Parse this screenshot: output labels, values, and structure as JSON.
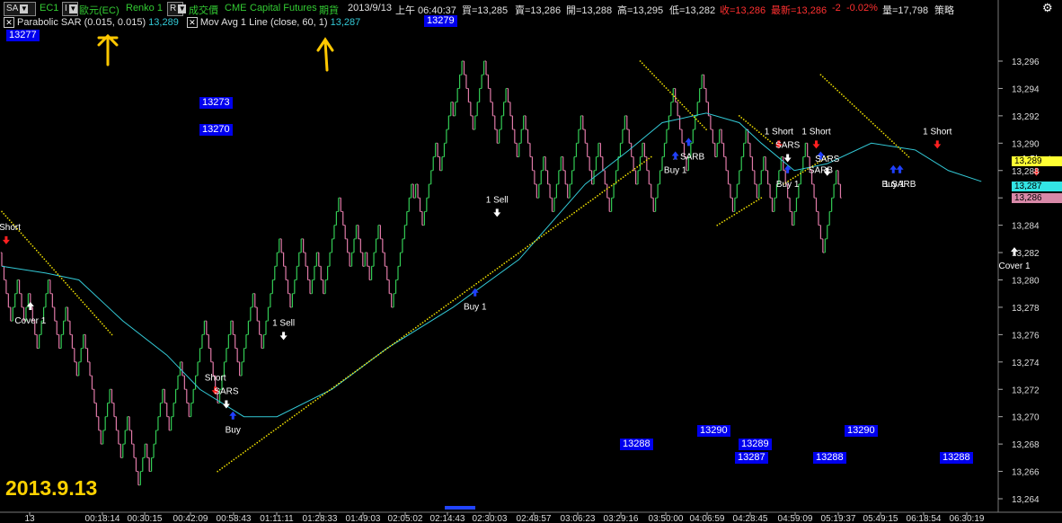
{
  "toolbar": {
    "symbol": "SA",
    "symbol_code": "EC1",
    "interval_btn": "I",
    "symbol_name": "歐元(EC)",
    "bar_type": "Renko 1",
    "mode_btn": "R",
    "price_type": "成交價",
    "exchange": "CME",
    "broker": "Capital Futures",
    "market": "期貨",
    "date": "2013/9/13",
    "time": "上午 06:40:37",
    "bid": "買=13,285",
    "ask": "賣=13,286",
    "open": "開=13,288",
    "high": "高=13,295",
    "low": "低=13,282",
    "close": "收=13,286",
    "last": "最新=13,286",
    "change": "-2",
    "change_pct": "-0.02%",
    "volume": "量=17,798",
    "strategy": "策略"
  },
  "indicators": [
    {
      "name": "Parabolic SAR",
      "params": "(0.015, 0.015)",
      "value": "13,289"
    },
    {
      "name": "Mov Avg 1 Line",
      "params": "(close, 60, 1)",
      "value": "13,287"
    }
  ],
  "notes": [
    "13277",
    "13279",
    "13273",
    "13270",
    "13288",
    "13290",
    "13289",
    "13287",
    "13288",
    "13290",
    "13288"
  ],
  "date_label": "2013.9.13",
  "price_tags": [
    "13,289",
    "13,287",
    "13,286"
  ],
  "colors": {
    "up": "#33cc55",
    "down": "#e07aa8",
    "sar": "#f5e400",
    "ma": "#33c9d6",
    "price_tag_yellow": "#ffff33",
    "price_tag_cyan": "#33e5e5",
    "price_tag_pink": "#d889a8"
  },
  "chart_data": {
    "type": "line",
    "y_axis": {
      "range": [
        13263,
        13297
      ],
      "ticks": [
        "13,296",
        "13,294",
        "13,292",
        "13,290",
        "13,288",
        "13,286",
        "13,284",
        "13,282",
        "13,280",
        "13,278",
        "13,276",
        "13,274",
        "13,272",
        "13,270",
        "13,268",
        "13,266",
        "13,264"
      ]
    },
    "x_axis": {
      "ticks": [
        "13",
        "00:18:14",
        "00:30:15",
        "00:42:09",
        "00:58:43",
        "01:11:11",
        "01:28:33",
        "01:49:03",
        "02:05:02",
        "02:14:43",
        "02:30:03",
        "02:48:57",
        "03:06:23",
        "03:29:16",
        "03:50:00",
        "04:06:59",
        "04:28:45",
        "04:59:09",
        "05:19:37",
        "05:49:15",
        "06:18:54",
        "06:30:19"
      ]
    },
    "series": [
      {
        "name": "Renko 1",
        "style": "renko",
        "path": [
          13282,
          13277,
          13280,
          13277,
          13279,
          13275,
          13280,
          13278,
          13275,
          13278,
          13273,
          13276,
          13268,
          13272,
          13267,
          13270,
          13265,
          13268,
          13266,
          13272,
          13269,
          13274,
          13270,
          13277,
          13271,
          13277,
          13273,
          13279,
          13275,
          13283,
          13278,
          13283,
          13279,
          13282,
          13279,
          13286,
          13281,
          13284,
          13281,
          13282,
          13280,
          13284,
          13278,
          13287,
          13286,
          13287,
          13284,
          13290,
          13288,
          13293,
          13292,
          13296,
          13291,
          13296,
          13290,
          13294,
          13289,
          13292,
          13286,
          13289,
          13285,
          13289,
          13286,
          13292,
          13287,
          13290,
          13285,
          13292,
          13287,
          13290,
          13285,
          13294,
          13288,
          13295,
          13289,
          13291,
          13285,
          13291,
          13286,
          13289,
          13285,
          13289,
          13284,
          13290,
          13282,
          13288,
          13286
        ]
      },
      {
        "name": "Parabolic SAR",
        "style": "dots",
        "segments": [
          [
            [
              0,
              13285
            ],
            [
              50,
              13276
            ]
          ],
          [
            [
              98,
              13266
            ],
            [
              295,
              13289
            ]
          ],
          [
            [
              290,
              13296
            ],
            [
              320,
              13291
            ]
          ],
          [
            [
              325,
              13284
            ],
            [
              345,
              13286
            ]
          ],
          [
            [
              335,
              13292
            ],
            [
              350,
              13290
            ]
          ],
          [
            [
              355,
              13287
            ],
            [
              375,
              13289
            ]
          ],
          [
            [
              372,
              13295
            ],
            [
              412,
              13289
            ]
          ]
        ]
      },
      {
        "name": "Mov Avg 1 Line",
        "style": "line",
        "points": [
          [
            0,
            13281
          ],
          [
            20,
            13280.5
          ],
          [
            35,
            13280
          ],
          [
            55,
            13277
          ],
          [
            75,
            13274.5
          ],
          [
            90,
            13272
          ],
          [
            110,
            13270
          ],
          [
            125,
            13270
          ],
          [
            150,
            13272
          ],
          [
            175,
            13275
          ],
          [
            205,
            13278
          ],
          [
            235,
            13281.5
          ],
          [
            265,
            13287
          ],
          [
            285,
            13289.5
          ],
          [
            300,
            13291.5
          ],
          [
            320,
            13292.2
          ],
          [
            335,
            13291.5
          ],
          [
            345,
            13290
          ],
          [
            360,
            13288
          ],
          [
            375,
            13288.5
          ],
          [
            395,
            13290
          ],
          [
            415,
            13289.5
          ],
          [
            430,
            13288
          ],
          [
            445,
            13287.2
          ]
        ]
      }
    ],
    "signals": [
      {
        "label": "1 Short",
        "type": "short",
        "x": 2,
        "y": 13283
      },
      {
        "label": "Cover 1",
        "type": "cover",
        "x": 13,
        "y": 13278
      },
      {
        "label": "Short",
        "type": "short",
        "x": 97,
        "y": 13272
      },
      {
        "label": "SARS",
        "type": "sars",
        "x": 102,
        "y": 13271
      },
      {
        "label": "Buy",
        "type": "buy",
        "x": 105,
        "y": 13270
      },
      {
        "label": "1 Sell",
        "type": "sell",
        "x": 128,
        "y": 13276
      },
      {
        "label": "1 Sell",
        "type": "sell",
        "x": 225,
        "y": 13285
      },
      {
        "label": "Buy 1",
        "type": "buy",
        "x": 215,
        "y": 13279
      },
      {
        "label": "1 SARB",
        "type": "sarb",
        "x": 312,
        "y": 13290
      },
      {
        "label": "Buy 1",
        "type": "buy",
        "x": 306,
        "y": 13289
      },
      {
        "label": "1 Short",
        "type": "short",
        "x": 353,
        "y": 13290
      },
      {
        "label": "SARS",
        "type": "sars",
        "x": 357,
        "y": 13289
      },
      {
        "label": "Buy 1",
        "type": "buy",
        "x": 357,
        "y": 13288
      },
      {
        "label": "1 Short",
        "type": "short",
        "x": 370,
        "y": 13290
      },
      {
        "label": "SARB",
        "type": "sarb",
        "x": 372,
        "y": 13289
      },
      {
        "label": "SARS",
        "type": "sars",
        "x": 375,
        "y": 13288
      },
      {
        "label": "1 SARB",
        "type": "sarb",
        "x": 408,
        "y": 13288
      },
      {
        "label": "Buy 1",
        "type": "buy",
        "x": 405,
        "y": 13288
      },
      {
        "label": "1 Short",
        "type": "short",
        "x": 425,
        "y": 13290
      },
      {
        "label": "Cover 1",
        "type": "cover",
        "x": 460,
        "y": 13282
      },
      {
        "label": "1 Short",
        "type": "short",
        "x": 470,
        "y": 13288
      }
    ]
  }
}
